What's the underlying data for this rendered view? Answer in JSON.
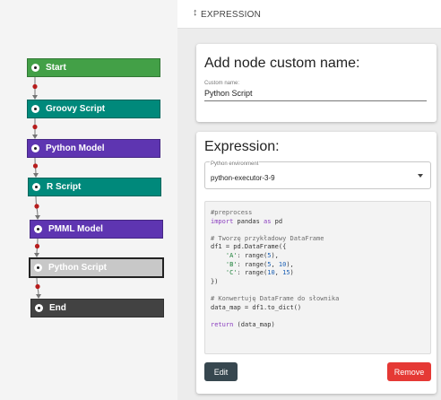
{
  "canvas": {
    "nodes": [
      {
        "label": "Start",
        "color": "#43a047"
      },
      {
        "label": "Groovy Script",
        "color": "#00897b"
      },
      {
        "label": "Python Model",
        "color": "#5e35b1"
      },
      {
        "label": "R Script",
        "color": "#00897b"
      },
      {
        "label": "PMML Model",
        "color": "#5e35b1"
      },
      {
        "label": "Python Script",
        "color": "#c8c8c8",
        "selected": true
      },
      {
        "label": "End",
        "color": "#424242"
      }
    ],
    "edge_color": "#757575",
    "port_color": "#b71c1c"
  },
  "header": {
    "title": "EXPRESSION",
    "icon": "sort-arrows-icon"
  },
  "custom_name_card": {
    "title": "Add node custom name:",
    "field_label": "Custom name:",
    "field_value": "Python Script"
  },
  "expression_card": {
    "title": "Expression:",
    "env_label": "Python environment",
    "env_value": "python-executor-3-9",
    "code_lines": [
      "#preprocess",
      "import pandas as pd",
      "",
      "# Tworzę przykładowy DataFrame",
      "df1 = pd.DataFrame({",
      "    'A': range(5),",
      "    'B': range(5, 10),",
      "    'C': range(10, 15)",
      "})",
      "",
      "# Konwertuję DataFrame do słownika",
      "data_map = df1.to_dict()",
      "",
      "return (data_map)"
    ],
    "edit_label": "Edit",
    "remove_label": "Remove"
  }
}
